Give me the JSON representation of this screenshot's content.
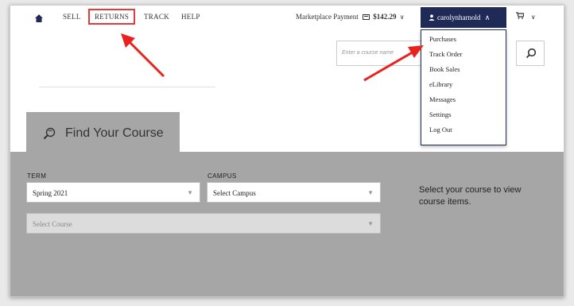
{
  "nav": {
    "items": [
      "SELL",
      "RETURNS",
      "TRACK",
      "HELP"
    ],
    "marketplace_label": "Marketplace Payment",
    "marketplace_amount": "$142.29",
    "user": "carolynharnold"
  },
  "user_menu": {
    "items": [
      "Purchases",
      "Track Order",
      "Book Sales",
      "eLibrary",
      "Messages",
      "Settings",
      "Log Out"
    ]
  },
  "search": {
    "placeholder": "Enter a course name"
  },
  "find_course": {
    "title": "Find Your Course",
    "term_label": "TERM",
    "term_value": "Spring 2021",
    "campus_label": "CAMPUS",
    "campus_value": "Select Campus",
    "course_value": "Select Course",
    "side_message": "Select your course to view course items."
  },
  "colors": {
    "user_button": "#1f2a56",
    "highlight": "#e23b3b",
    "panel": "#a6a6a6"
  },
  "icons": [
    "home-icon",
    "wallet-icon",
    "person-icon",
    "chevron-down-icon",
    "cart-icon",
    "search-icon",
    "find-course-search-icon"
  ]
}
